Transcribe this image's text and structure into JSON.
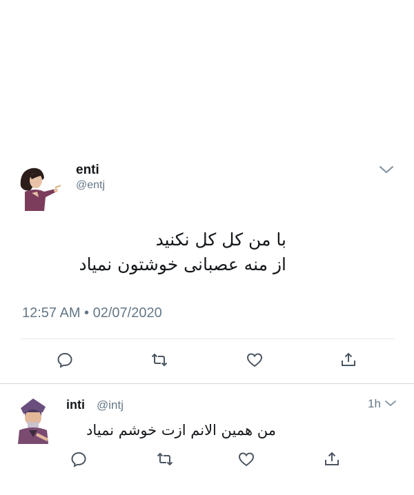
{
  "main_tweet": {
    "display_name": "enti",
    "handle": "@entj",
    "text_lines": [
      "با من کل کل نکنید",
      "از منه عصبانی خوشتون نمیاد"
    ],
    "timestamp": "12:57 AM • 02/07/2020"
  },
  "reply_tweet": {
    "display_name": "inti",
    "handle": "@intj",
    "time": "1h",
    "text": "من همین الانم ازت خوشم نمیاد"
  },
  "icons": {
    "reply": "reply-icon",
    "retweet": "retweet-icon",
    "like": "heart-icon",
    "share": "share-icon",
    "menu": "chevron-down-icon"
  },
  "colors": {
    "text": "#14171a",
    "secondary": "#657786",
    "divider": "#e1e8ed"
  }
}
